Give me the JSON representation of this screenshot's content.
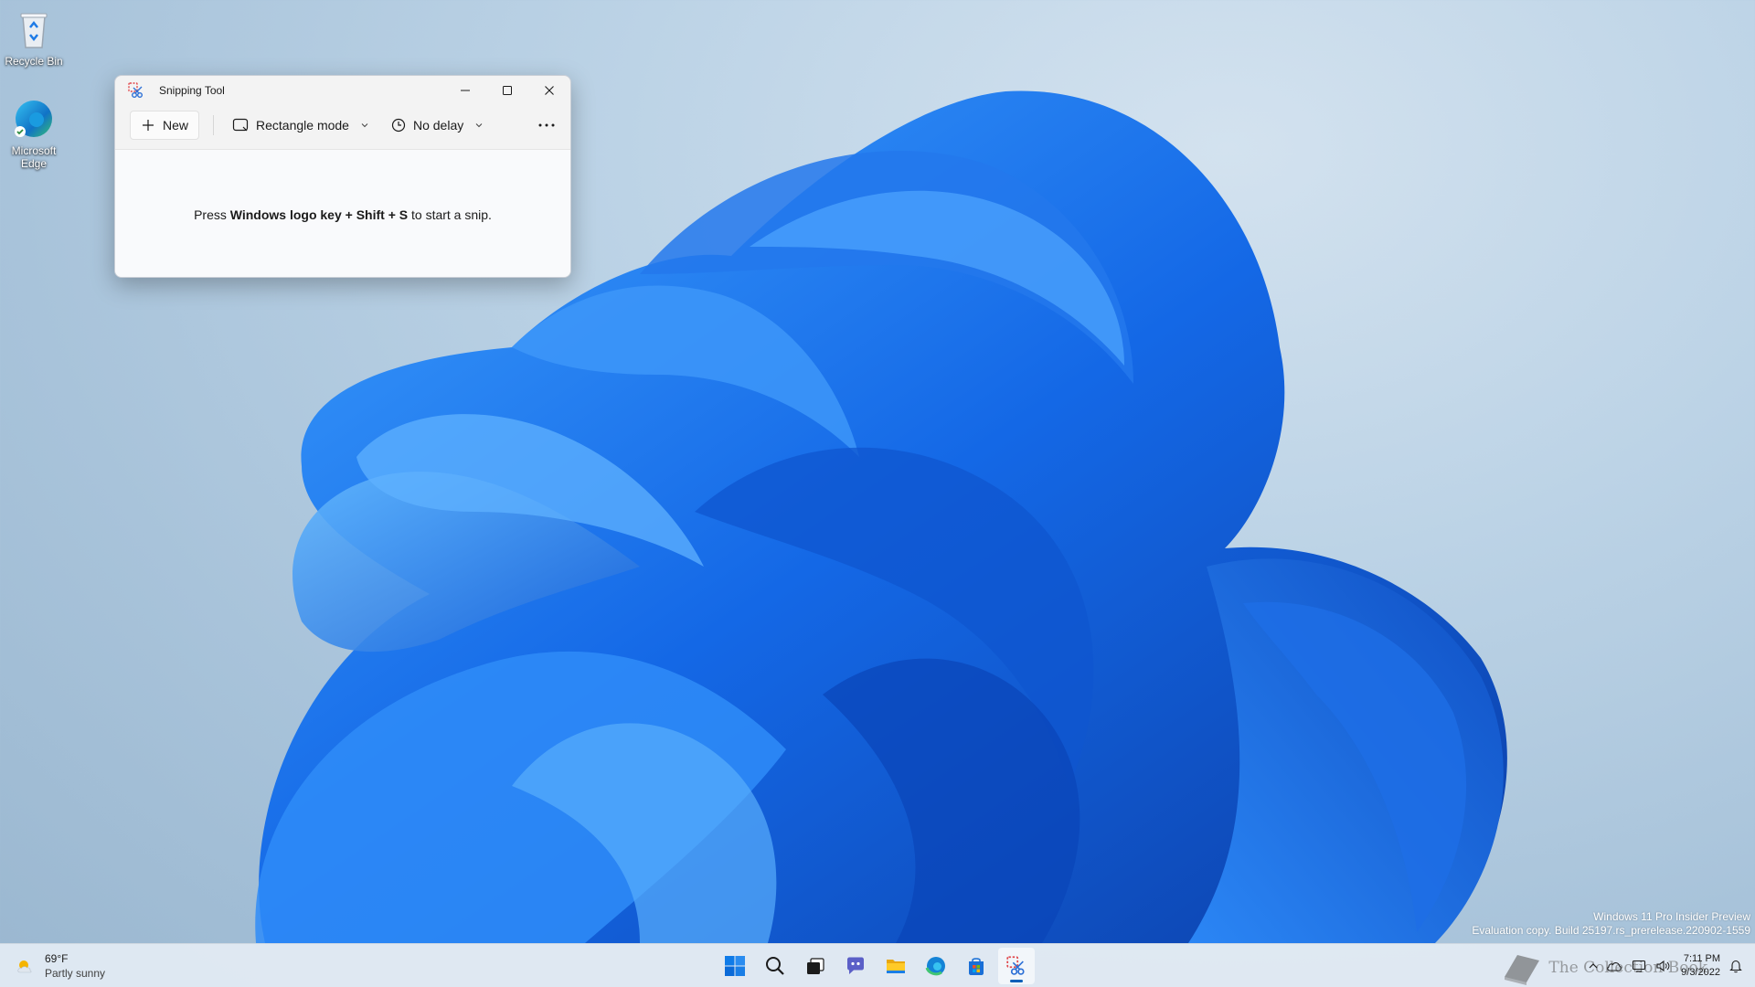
{
  "desktop": {
    "icons": [
      {
        "label": "Recycle Bin",
        "icon": "recycle-bin-icon"
      },
      {
        "label": "Microsoft Edge",
        "icon": "edge-icon"
      }
    ]
  },
  "window": {
    "title": "Snipping Tool",
    "app_icon": "scissors-icon",
    "toolbar": {
      "new_label": "New",
      "mode_label": "Rectangle mode",
      "delay_label": "No delay",
      "more_icon": "more-icon"
    },
    "content": {
      "prefix": "Press ",
      "bold1": "Windows logo key + Shift + S",
      "suffix": " to start a snip."
    }
  },
  "watermark": {
    "line1": "Windows 11 Pro Insider Preview",
    "line2": "Evaluation copy. Build 25197.rs_prerelease.220902-1559"
  },
  "taskbar": {
    "weather": {
      "temp": "69°F",
      "condition": "Partly sunny"
    },
    "apps": [
      "start-icon",
      "search-icon",
      "task-view-icon",
      "teams-chat-icon",
      "file-explorer-icon",
      "edge-icon",
      "store-icon",
      "snipping-tool-icon"
    ],
    "clock": {
      "time": "7:11 PM",
      "date": "9/3/2022"
    },
    "logo_text": "The Collection Book"
  },
  "colors": {
    "accent": "#005fb8",
    "bloom": "#1a6fe8"
  }
}
